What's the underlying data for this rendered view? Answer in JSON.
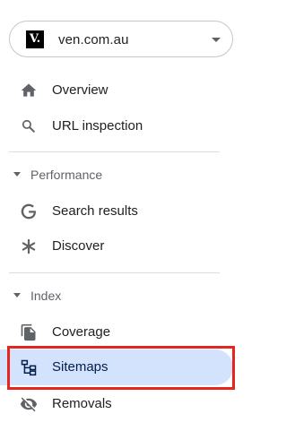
{
  "property": {
    "favicon_text": "V.",
    "name": "ven.com.au",
    "dropdown_icon": "arrow-drop-down-icon"
  },
  "nav": {
    "overview": {
      "label": "Overview",
      "icon": "home-icon"
    },
    "url_inspection": {
      "label": "URL inspection",
      "icon": "search-icon"
    }
  },
  "performance": {
    "header": "Performance",
    "items": [
      {
        "label": "Search results",
        "icon": "google-g-icon"
      },
      {
        "label": "Discover",
        "icon": "asterisk-icon"
      }
    ]
  },
  "index": {
    "header": "Index",
    "items": [
      {
        "label": "Coverage",
        "icon": "file-copy-icon"
      },
      {
        "label": "Sitemaps",
        "icon": "sitemap-icon",
        "active": true
      },
      {
        "label": "Removals",
        "icon": "visibility-off-icon"
      }
    ]
  },
  "colors": {
    "active_bg": "#d3e3fd",
    "highlight_border": "#e5261f",
    "icon": "#5f6368"
  }
}
